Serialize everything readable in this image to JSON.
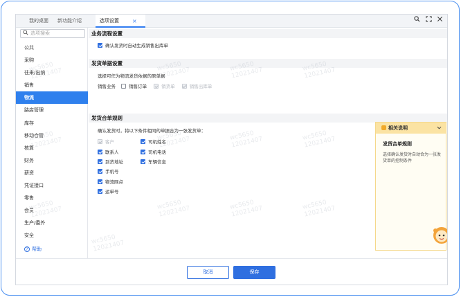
{
  "tabs": [
    {
      "label": "我的桌面"
    },
    {
      "label": "新功能介绍"
    },
    {
      "label": "选项设置",
      "active": true
    }
  ],
  "tab_close": "×",
  "toolbar_icons": [
    "search-icon",
    "expand-icon",
    "close-icon"
  ],
  "sidebar": {
    "search_placeholder": "选项搜索",
    "items": [
      {
        "label": "公共"
      },
      {
        "label": "采购"
      },
      {
        "label": "往来/出纳"
      },
      {
        "label": "销售"
      },
      {
        "label": "物流",
        "active": true
      },
      {
        "label": "路店管理"
      },
      {
        "label": "库存"
      },
      {
        "label": "移动仓管"
      },
      {
        "label": "核算"
      },
      {
        "label": "财务"
      },
      {
        "label": "薪资"
      },
      {
        "label": "凭证接口"
      },
      {
        "label": "零售"
      },
      {
        "label": "会员"
      },
      {
        "label": "生产/委外"
      },
      {
        "label": "安全"
      }
    ],
    "help_label": "帮助"
  },
  "sections": {
    "workflow": {
      "title": "业务流程设置",
      "auto_generate": {
        "label": "确认发货时自动生成销售出库单",
        "checked": true
      }
    },
    "source": {
      "title": "发货单据设置",
      "desc": "选择可作为物流发货依据的原单据",
      "group_label": "销售业务",
      "options": [
        {
          "label": "销售订单",
          "state": "unchecked"
        },
        {
          "label": "销货单",
          "state": "disabled-checked"
        },
        {
          "label": "销售出库单",
          "state": "disabled-checked"
        }
      ]
    },
    "merge": {
      "title": "发货合单规则",
      "desc": "确认发货时，将以下条件相同的单据合为一张发货单：",
      "left": [
        {
          "label": "客户",
          "state": "disabled-checked"
        },
        {
          "label": "联系人",
          "state": "checked"
        },
        {
          "label": "到货地址",
          "state": "checked"
        },
        {
          "label": "手机号",
          "state": "checked"
        },
        {
          "label": "物流网点",
          "state": "checked"
        },
        {
          "label": "运单号",
          "state": "checked"
        }
      ],
      "right": [
        {
          "label": "司机姓名",
          "state": "checked"
        },
        {
          "label": "司机电话",
          "state": "checked"
        },
        {
          "label": "车辆信息",
          "state": "checked"
        }
      ]
    }
  },
  "help_panel": {
    "header": "相关说明",
    "title": "发货合单规则",
    "desc": "选择确认发货时自动合为一张发货单的控制条件"
  },
  "footer": {
    "cancel": "取消",
    "save": "保存"
  },
  "watermark": {
    "line1": "wc5650",
    "line2": "12021407"
  },
  "colors": {
    "accent": "#2f80ed",
    "help_bg": "#fffdf3",
    "help_header": "#fbe3a3"
  }
}
